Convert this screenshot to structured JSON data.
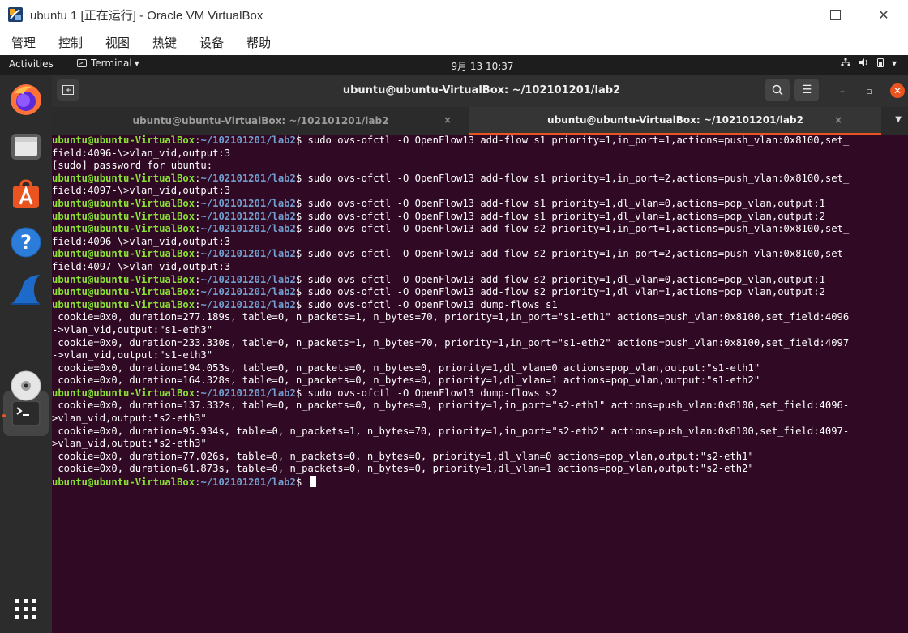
{
  "host_window": {
    "title": "ubuntu 1 [正在运行] - Oracle VM VirtualBox",
    "controls": [
      "minimize",
      "maximize",
      "close"
    ],
    "close_symbol": "✕"
  },
  "vbox_menu": [
    "管理",
    "控制",
    "视图",
    "热键",
    "设备",
    "帮助"
  ],
  "gnome_topbar": {
    "activities": "Activities",
    "app_menu": "Terminal",
    "app_menu_arrow": "▾",
    "clock": "9月 13  10:37",
    "tray": {
      "network": "⊞",
      "volume": "◀)",
      "power": "▮",
      "arrow": "▾"
    }
  },
  "dock": {
    "items": [
      "firefox-icon",
      "files-icon",
      "software-center-icon",
      "help-icon",
      "wireshark-icon",
      "terminal-icon",
      "disc-icon"
    ],
    "show_apps_icon": "apps-grid-icon"
  },
  "terminal": {
    "header_title": "ubuntu@ubuntu-VirtualBox: ~/102101201/lab2",
    "new_tab_symbol": "⊞",
    "search_symbol": "⌕",
    "menu_symbol": "☰",
    "minimize_symbol": "–",
    "restore_symbol": "▫",
    "close_symbol": "✕",
    "tabs": [
      {
        "label": "ubuntu@ubuntu-VirtualBox: ~/102101201/lab2",
        "active": false,
        "close": "×"
      },
      {
        "label": "ubuntu@ubuntu-VirtualBox: ~/102101201/lab2",
        "active": true,
        "close": "×"
      }
    ],
    "tab_menu_symbol": "▼",
    "prompt": {
      "user": "ubuntu@ubuntu-VirtualBox",
      "colon": ":",
      "path": "~/102101201/lab2",
      "dollar": "$ "
    },
    "lines": [
      {
        "prompt": true,
        "text": "sudo ovs-ofctl -O OpenFlow13 add-flow s1 priority=1,in_port=1,actions=push_vlan:0x8100,set_"
      },
      {
        "prompt": false,
        "text": "field:4096-\\>vlan_vid,output:3"
      },
      {
        "prompt": false,
        "text": "[sudo] password for ubuntu:"
      },
      {
        "prompt": true,
        "text": "sudo ovs-ofctl -O OpenFlow13 add-flow s1 priority=1,in_port=2,actions=push_vlan:0x8100,set_"
      },
      {
        "prompt": false,
        "text": "field:4097-\\>vlan_vid,output:3"
      },
      {
        "prompt": true,
        "text": "sudo ovs-ofctl -O OpenFlow13 add-flow s1 priority=1,dl_vlan=0,actions=pop_vlan,output:1"
      },
      {
        "prompt": true,
        "text": "sudo ovs-ofctl -O OpenFlow13 add-flow s1 priority=1,dl_vlan=1,actions=pop_vlan,output:2"
      },
      {
        "prompt": true,
        "text": "sudo ovs-ofctl -O OpenFlow13 add-flow s2 priority=1,in_port=1,actions=push_vlan:0x8100,set_"
      },
      {
        "prompt": false,
        "text": "field:4096-\\>vlan_vid,output:3"
      },
      {
        "prompt": true,
        "text": "sudo ovs-ofctl -O OpenFlow13 add-flow s2 priority=1,in_port=2,actions=push_vlan:0x8100,set_"
      },
      {
        "prompt": false,
        "text": "field:4097-\\>vlan_vid,output:3"
      },
      {
        "prompt": true,
        "text": "sudo ovs-ofctl -O OpenFlow13 add-flow s2 priority=1,dl_vlan=0,actions=pop_vlan,output:1"
      },
      {
        "prompt": true,
        "text": "sudo ovs-ofctl -O OpenFlow13 add-flow s2 priority=1,dl_vlan=1,actions=pop_vlan,output:2"
      },
      {
        "prompt": true,
        "text": "sudo ovs-ofctl -O OpenFlow13 dump-flows s1"
      },
      {
        "prompt": false,
        "text": " cookie=0x0, duration=277.189s, table=0, n_packets=1, n_bytes=70, priority=1,in_port=\"s1-eth1\" actions=push_vlan:0x8100,set_field:4096"
      },
      {
        "prompt": false,
        "text": "->vlan_vid,output:\"s1-eth3\""
      },
      {
        "prompt": false,
        "text": " cookie=0x0, duration=233.330s, table=0, n_packets=1, n_bytes=70, priority=1,in_port=\"s1-eth2\" actions=push_vlan:0x8100,set_field:4097"
      },
      {
        "prompt": false,
        "text": "->vlan_vid,output:\"s1-eth3\""
      },
      {
        "prompt": false,
        "text": " cookie=0x0, duration=194.053s, table=0, n_packets=0, n_bytes=0, priority=1,dl_vlan=0 actions=pop_vlan,output:\"s1-eth1\""
      },
      {
        "prompt": false,
        "text": " cookie=0x0, duration=164.328s, table=0, n_packets=0, n_bytes=0, priority=1,dl_vlan=1 actions=pop_vlan,output:\"s1-eth2\""
      },
      {
        "prompt": true,
        "text": "sudo ovs-ofctl -O OpenFlow13 dump-flows s2"
      },
      {
        "prompt": false,
        "text": " cookie=0x0, duration=137.332s, table=0, n_packets=0, n_bytes=0, priority=1,in_port=\"s2-eth1\" actions=push_vlan:0x8100,set_field:4096-"
      },
      {
        "prompt": false,
        "text": ">vlan_vid,output:\"s2-eth3\""
      },
      {
        "prompt": false,
        "text": " cookie=0x0, duration=95.934s, table=0, n_packets=1, n_bytes=70, priority=1,in_port=\"s2-eth2\" actions=push_vlan:0x8100,set_field:4097-"
      },
      {
        "prompt": false,
        "text": ">vlan_vid,output:\"s2-eth3\""
      },
      {
        "prompt": false,
        "text": " cookie=0x0, duration=77.026s, table=0, n_packets=0, n_bytes=0, priority=1,dl_vlan=0 actions=pop_vlan,output:\"s2-eth1\""
      },
      {
        "prompt": false,
        "text": " cookie=0x0, duration=61.873s, table=0, n_packets=0, n_bytes=0, priority=1,dl_vlan=1 actions=pop_vlan,output:\"s2-eth2\""
      },
      {
        "prompt": true,
        "text": "",
        "cursor": true
      }
    ]
  },
  "colors": {
    "terminal_bg": "#300a24",
    "prompt_user": "#8ae234",
    "prompt_path": "#729fcf",
    "accent": "#e95420"
  }
}
